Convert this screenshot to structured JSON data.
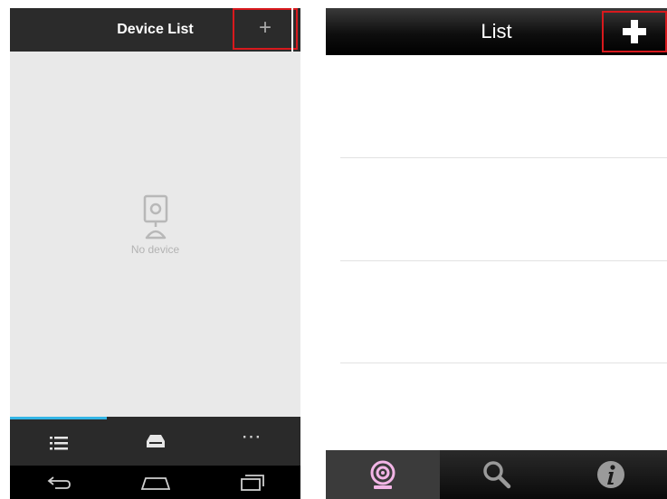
{
  "left_app": {
    "header": {
      "title": "Device List",
      "add_label": "+"
    },
    "empty_state": {
      "text": "No device"
    },
    "tabs": [
      {
        "name": "devices",
        "icon": "list-icon",
        "active": true
      },
      {
        "name": "storage",
        "icon": "tray-icon",
        "active": false
      },
      {
        "name": "more",
        "icon": "more-dots-icon",
        "label": "⋯",
        "active": false
      }
    ],
    "nav_bar": [
      "back-icon",
      "home-icon",
      "recent-apps-icon"
    ],
    "colors": {
      "header": "#2b2b2b",
      "background": "#e9e9e9",
      "active_tab": "#33b5e5",
      "highlight": "#d8191d"
    }
  },
  "right_app": {
    "header": {
      "title": "List"
    },
    "tabs": [
      {
        "name": "camera",
        "icon": "webcam-icon",
        "active": true
      },
      {
        "name": "search",
        "icon": "search-icon",
        "active": false
      },
      {
        "name": "info",
        "icon": "info-icon",
        "active": false
      }
    ],
    "colors": {
      "header": "#000000",
      "webcam": "#f2b5e6",
      "highlight": "#d8191d"
    }
  }
}
